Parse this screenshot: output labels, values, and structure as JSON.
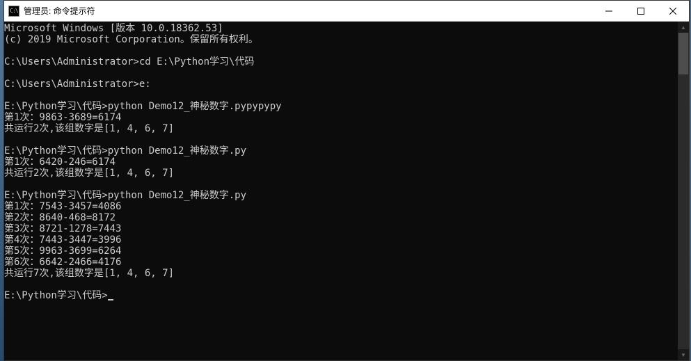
{
  "window": {
    "title": "管理员: 命令提示符",
    "icon_label": "C:\\"
  },
  "terminal": {
    "lines": [
      "Microsoft Windows [版本 10.0.18362.53]",
      "(c) 2019 Microsoft Corporation。保留所有权利。",
      "",
      "C:\\Users\\Administrator>cd E:\\Python学习\\代码",
      "",
      "C:\\Users\\Administrator>e:",
      "",
      "E:\\Python学习\\代码>python Demo12_神秘数字.pypypypy",
      "第1次：9863-3689=6174",
      "共运行2次,该组数字是[1, 4, 6, 7]",
      "",
      "E:\\Python学习\\代码>python Demo12_神秘数字.py",
      "第1次：6420-246=6174",
      "共运行2次,该组数字是[1, 4, 6, 7]",
      "",
      "E:\\Python学习\\代码>python Demo12_神秘数字.py",
      "第1次：7543-3457=4086",
      "第2次：8640-468=8172",
      "第3次：8721-1278=7443",
      "第4次：7443-3447=3996",
      "第5次：9963-3699=6264",
      "第6次：6642-2466=4176",
      "共运行7次,该组数字是[1, 4, 6, 7]",
      "",
      "E:\\Python学习\\代码>"
    ]
  }
}
